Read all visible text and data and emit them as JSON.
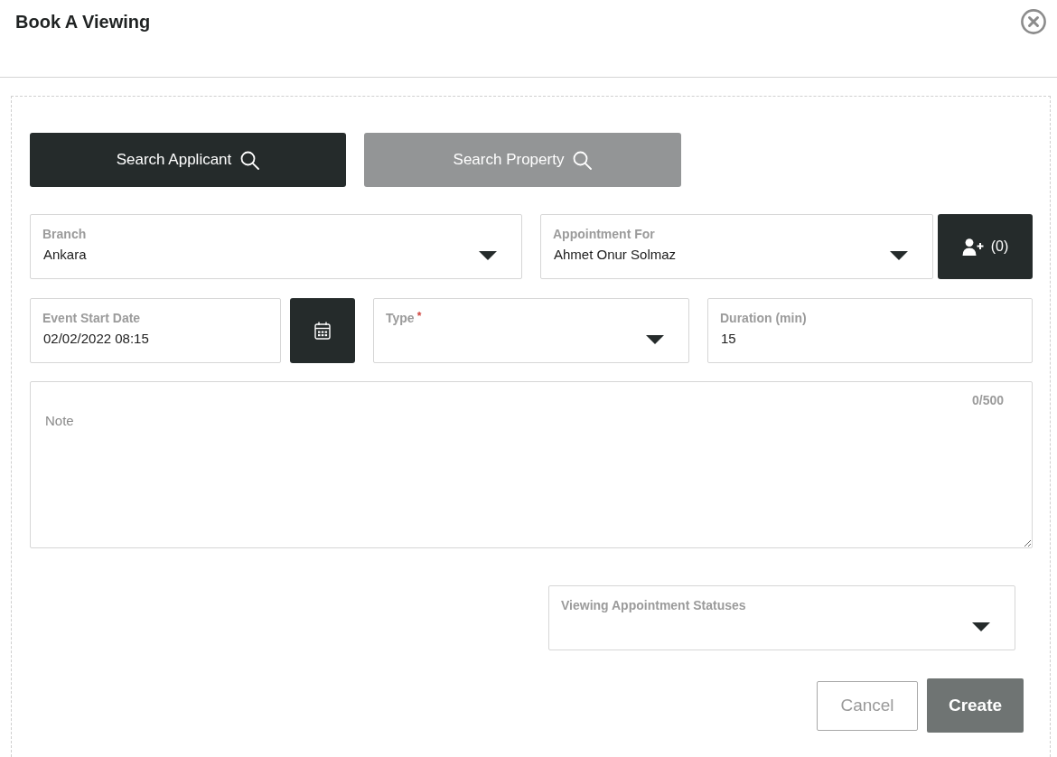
{
  "dialog": {
    "title": "Book A Viewing"
  },
  "search_buttons": [
    {
      "label": "Search Applicant",
      "selected": true
    },
    {
      "label": "Search Property",
      "selected": false
    }
  ],
  "branch": {
    "kind": "select",
    "label": "Branch",
    "value": "Ankara"
  },
  "appointment_for": {
    "kind": "select",
    "label": "Appointment For",
    "value": "Ahmet Onur Solmaz"
  },
  "attendees_button": {
    "label": "(0)"
  },
  "event_start_date": {
    "kind": "text",
    "label": "Event Start Date",
    "value": "02/02/2022 08:15"
  },
  "type": {
    "kind": "select",
    "label": "Type",
    "required_mark": "*"
  },
  "duration": {
    "kind": "text",
    "label": "Duration (min)",
    "value": "15"
  },
  "note": {
    "placeholder": "Note",
    "counter": "0/500"
  },
  "statuses": {
    "kind": "select",
    "label": "Viewing Appointment Statuses"
  },
  "buttons": [
    {
      "kind": "secondary",
      "label": "Cancel"
    },
    {
      "kind": "primary",
      "label": "Create"
    }
  ]
}
